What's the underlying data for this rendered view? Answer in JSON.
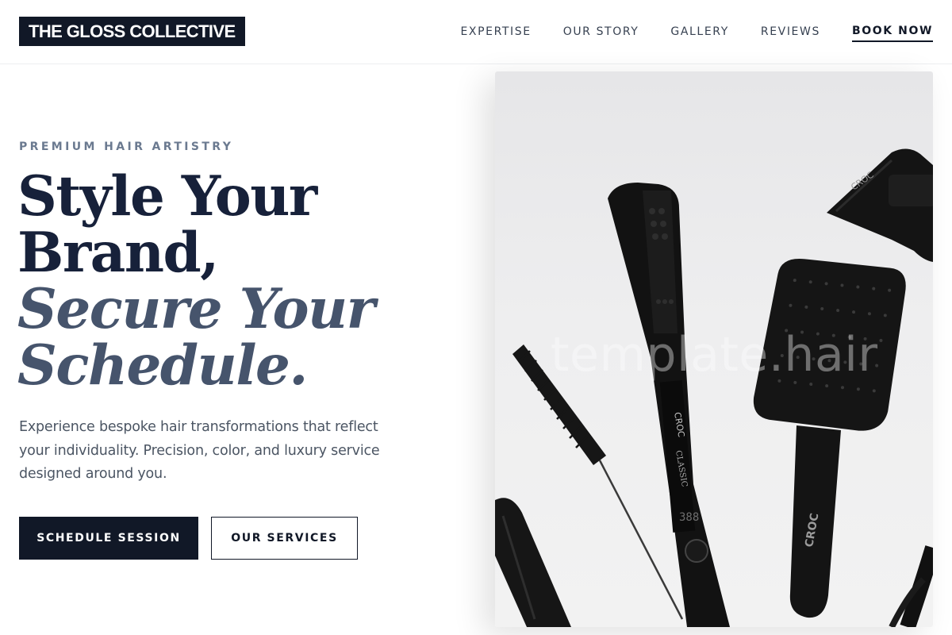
{
  "brand": {
    "name": "THE GLOSS COLLECTIVE"
  },
  "nav": {
    "items": [
      {
        "label": "EXPERTISE"
      },
      {
        "label": "OUR STORY"
      },
      {
        "label": "GALLERY"
      },
      {
        "label": "REVIEWS"
      }
    ],
    "cta": "BOOK NOW"
  },
  "hero": {
    "eyebrow": "PREMIUM HAIR ARTISTRY",
    "headline": {
      "line1": "Style Your",
      "line2": "Brand,",
      "line3": "Secure Your",
      "line4": "Schedule."
    },
    "description": "Experience bespoke hair transformations that reflect your individuality. Precision, color, and luxury service designed around you.",
    "primary_button": "SCHEDULE SESSION",
    "secondary_button": "OUR SERVICES",
    "image": {
      "subject": "hair-styling-tools",
      "watermark": "template.hair",
      "tool_brand": "CROC",
      "straightener_model": "CLASSIC",
      "temp_display": "388"
    }
  },
  "colors": {
    "primary": "#111827",
    "heading": "#17213a",
    "italic_heading": "#46546c",
    "eyebrow": "#6b7a90",
    "body_text": "#4b5563"
  }
}
